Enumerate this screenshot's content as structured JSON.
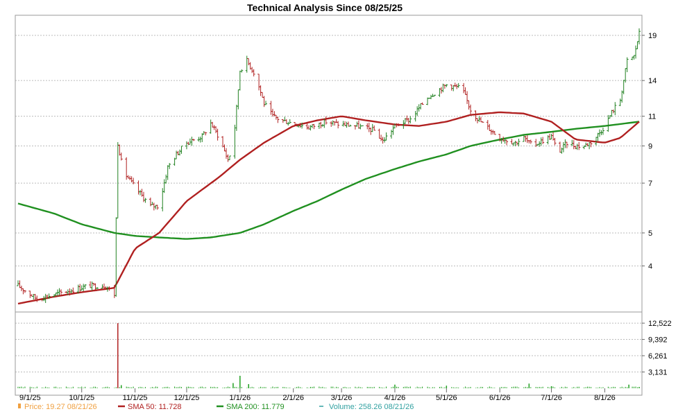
{
  "chart_data": {
    "type": "line",
    "title": "Technical Analysis Since 08/25/25",
    "x_ticks": [
      "9/1/25",
      "10/1/25",
      "11/1/25",
      "12/1/25",
      "1/1/26",
      "2/1/26",
      "3/1/26",
      "4/1/26",
      "5/1/26",
      "6/1/26",
      "7/1/26",
      "8/1/26"
    ],
    "y_ticks": [
      4,
      5,
      7,
      9,
      11,
      14,
      19
    ],
    "ylim": [
      3,
      20
    ],
    "y_scale": "log",
    "grid": true,
    "volume_ticks": [
      "3,131",
      "6,261",
      "9,392",
      "12,522"
    ],
    "volume_ylim": [
      0,
      14000
    ],
    "legend": [
      {
        "id": "price",
        "label": "Price: 19.27  08/21/26",
        "color": "#f0a040"
      },
      {
        "id": "sma50",
        "label": "SMA 50: 11.728",
        "color": "#b02020"
      },
      {
        "id": "sma200",
        "label": "SMA 200: 11.779",
        "color": "#209020"
      },
      {
        "id": "volume",
        "label": "Volume: 258.26  08/21/26",
        "color": "#30a0a0"
      }
    ],
    "price_anchors": [
      [
        "8/25/25",
        3.5
      ],
      [
        "9/5/25",
        3.2
      ],
      [
        "9/15/25",
        3.3
      ],
      [
        "9/25/25",
        3.4
      ],
      [
        "10/5/25",
        3.5
      ],
      [
        "10/15/25",
        3.5
      ],
      [
        "10/20/25",
        3.3
      ],
      [
        "10/22/25",
        9.2
      ],
      [
        "10/25/25",
        7.6
      ],
      [
        "11/1/25",
        6.8
      ],
      [
        "11/10/25",
        6.0
      ],
      [
        "11/15/25",
        6.0
      ],
      [
        "11/20/25",
        7.8
      ],
      [
        "11/25/25",
        8.5
      ],
      [
        "12/1/25",
        9.2
      ],
      [
        "12/10/25",
        9.6
      ],
      [
        "12/15/25",
        10.5
      ],
      [
        "12/20/25",
        9.5
      ],
      [
        "12/25/25",
        8.2
      ],
      [
        "12/28/25",
        9.0
      ],
      [
        "1/1/26",
        15.0
      ],
      [
        "1/5/26",
        16.0
      ],
      [
        "1/10/26",
        14.5
      ],
      [
        "1/15/26",
        12.0
      ],
      [
        "1/20/26",
        11.0
      ],
      [
        "1/25/26",
        10.7
      ],
      [
        "2/1/26",
        10.5
      ],
      [
        "2/10/26",
        10.2
      ],
      [
        "2/20/26",
        10.6
      ],
      [
        "3/1/26",
        10.4
      ],
      [
        "3/10/26",
        10.3
      ],
      [
        "3/20/26",
        10.0
      ],
      [
        "3/25/26",
        9.3
      ],
      [
        "4/1/26",
        10.3
      ],
      [
        "4/10/26",
        10.8
      ],
      [
        "4/20/26",
        12.5
      ],
      [
        "4/27/26",
        13.2
      ],
      [
        "5/1/26",
        13.6
      ],
      [
        "5/10/26",
        13.3
      ],
      [
        "5/15/26",
        11.5
      ],
      [
        "5/20/26",
        10.7
      ],
      [
        "5/27/26",
        10.0
      ],
      [
        "6/1/26",
        9.5
      ],
      [
        "6/10/26",
        9.2
      ],
      [
        "6/15/26",
        9.5
      ],
      [
        "6/20/26",
        9.0
      ],
      [
        "6/25/26",
        9.3
      ],
      [
        "7/1/26",
        9.6
      ],
      [
        "7/5/26",
        8.6
      ],
      [
        "7/10/26",
        9.2
      ],
      [
        "7/15/26",
        9.0
      ],
      [
        "7/20/26",
        9.0
      ],
      [
        "7/25/26",
        9.3
      ],
      [
        "8/1/26",
        10.3
      ],
      [
        "8/5/26",
        11.3
      ],
      [
        "8/10/26",
        12.3
      ],
      [
        "8/14/26",
        16.0
      ],
      [
        "8/18/26",
        16.5
      ],
      [
        "8/21/26",
        19.27
      ]
    ],
    "sma50_anchors": [
      [
        "8/25/25",
        3.1
      ],
      [
        "9/15/25",
        3.25
      ],
      [
        "10/1/25",
        3.35
      ],
      [
        "10/20/25",
        3.45
      ],
      [
        "11/1/25",
        4.5
      ],
      [
        "11/15/25",
        5.0
      ],
      [
        "12/1/25",
        6.2
      ],
      [
        "12/20/25",
        7.3
      ],
      [
        "1/1/26",
        8.2
      ],
      [
        "1/15/26",
        9.2
      ],
      [
        "2/1/26",
        10.3
      ],
      [
        "2/15/26",
        10.7
      ],
      [
        "3/1/26",
        11.0
      ],
      [
        "3/15/26",
        10.7
      ],
      [
        "4/1/26",
        10.4
      ],
      [
        "4/15/26",
        10.3
      ],
      [
        "5/1/26",
        10.6
      ],
      [
        "5/15/26",
        11.1
      ],
      [
        "6/1/26",
        11.3
      ],
      [
        "6/15/26",
        11.2
      ],
      [
        "7/1/26",
        10.6
      ],
      [
        "7/15/26",
        9.4
      ],
      [
        "8/1/26",
        9.2
      ],
      [
        "8/10/26",
        9.5
      ],
      [
        "8/21/26",
        10.6
      ]
    ],
    "sma200_anchors": [
      [
        "8/25/25",
        6.1
      ],
      [
        "9/15/25",
        5.7
      ],
      [
        "10/1/25",
        5.3
      ],
      [
        "10/20/25",
        5.0
      ],
      [
        "11/1/25",
        4.9
      ],
      [
        "11/15/25",
        4.85
      ],
      [
        "12/1/25",
        4.8
      ],
      [
        "12/15/25",
        4.85
      ],
      [
        "1/1/26",
        5.0
      ],
      [
        "1/15/26",
        5.3
      ],
      [
        "2/1/26",
        5.8
      ],
      [
        "2/15/26",
        6.2
      ],
      [
        "3/1/26",
        6.7
      ],
      [
        "3/15/26",
        7.2
      ],
      [
        "4/1/26",
        7.7
      ],
      [
        "4/15/26",
        8.1
      ],
      [
        "5/1/26",
        8.5
      ],
      [
        "5/15/26",
        9.0
      ],
      [
        "6/1/26",
        9.4
      ],
      [
        "6/15/26",
        9.7
      ],
      [
        "7/1/26",
        9.9
      ],
      [
        "7/15/26",
        10.1
      ],
      [
        "8/1/26",
        10.3
      ],
      [
        "8/21/26",
        10.6
      ]
    ],
    "volume_spikes": [
      [
        "10/22/25",
        12522
      ],
      [
        "10/24/25",
        600
      ],
      [
        "12/28/25",
        1000
      ],
      [
        "1/1/26",
        2400
      ],
      [
        "1/6/26",
        800
      ],
      [
        "4/1/26",
        700
      ],
      [
        "5/1/26",
        500
      ],
      [
        "6/18/26",
        900
      ],
      [
        "7/1/26",
        400
      ],
      [
        "8/15/26",
        700
      ],
      [
        "8/21/26",
        258
      ]
    ]
  }
}
